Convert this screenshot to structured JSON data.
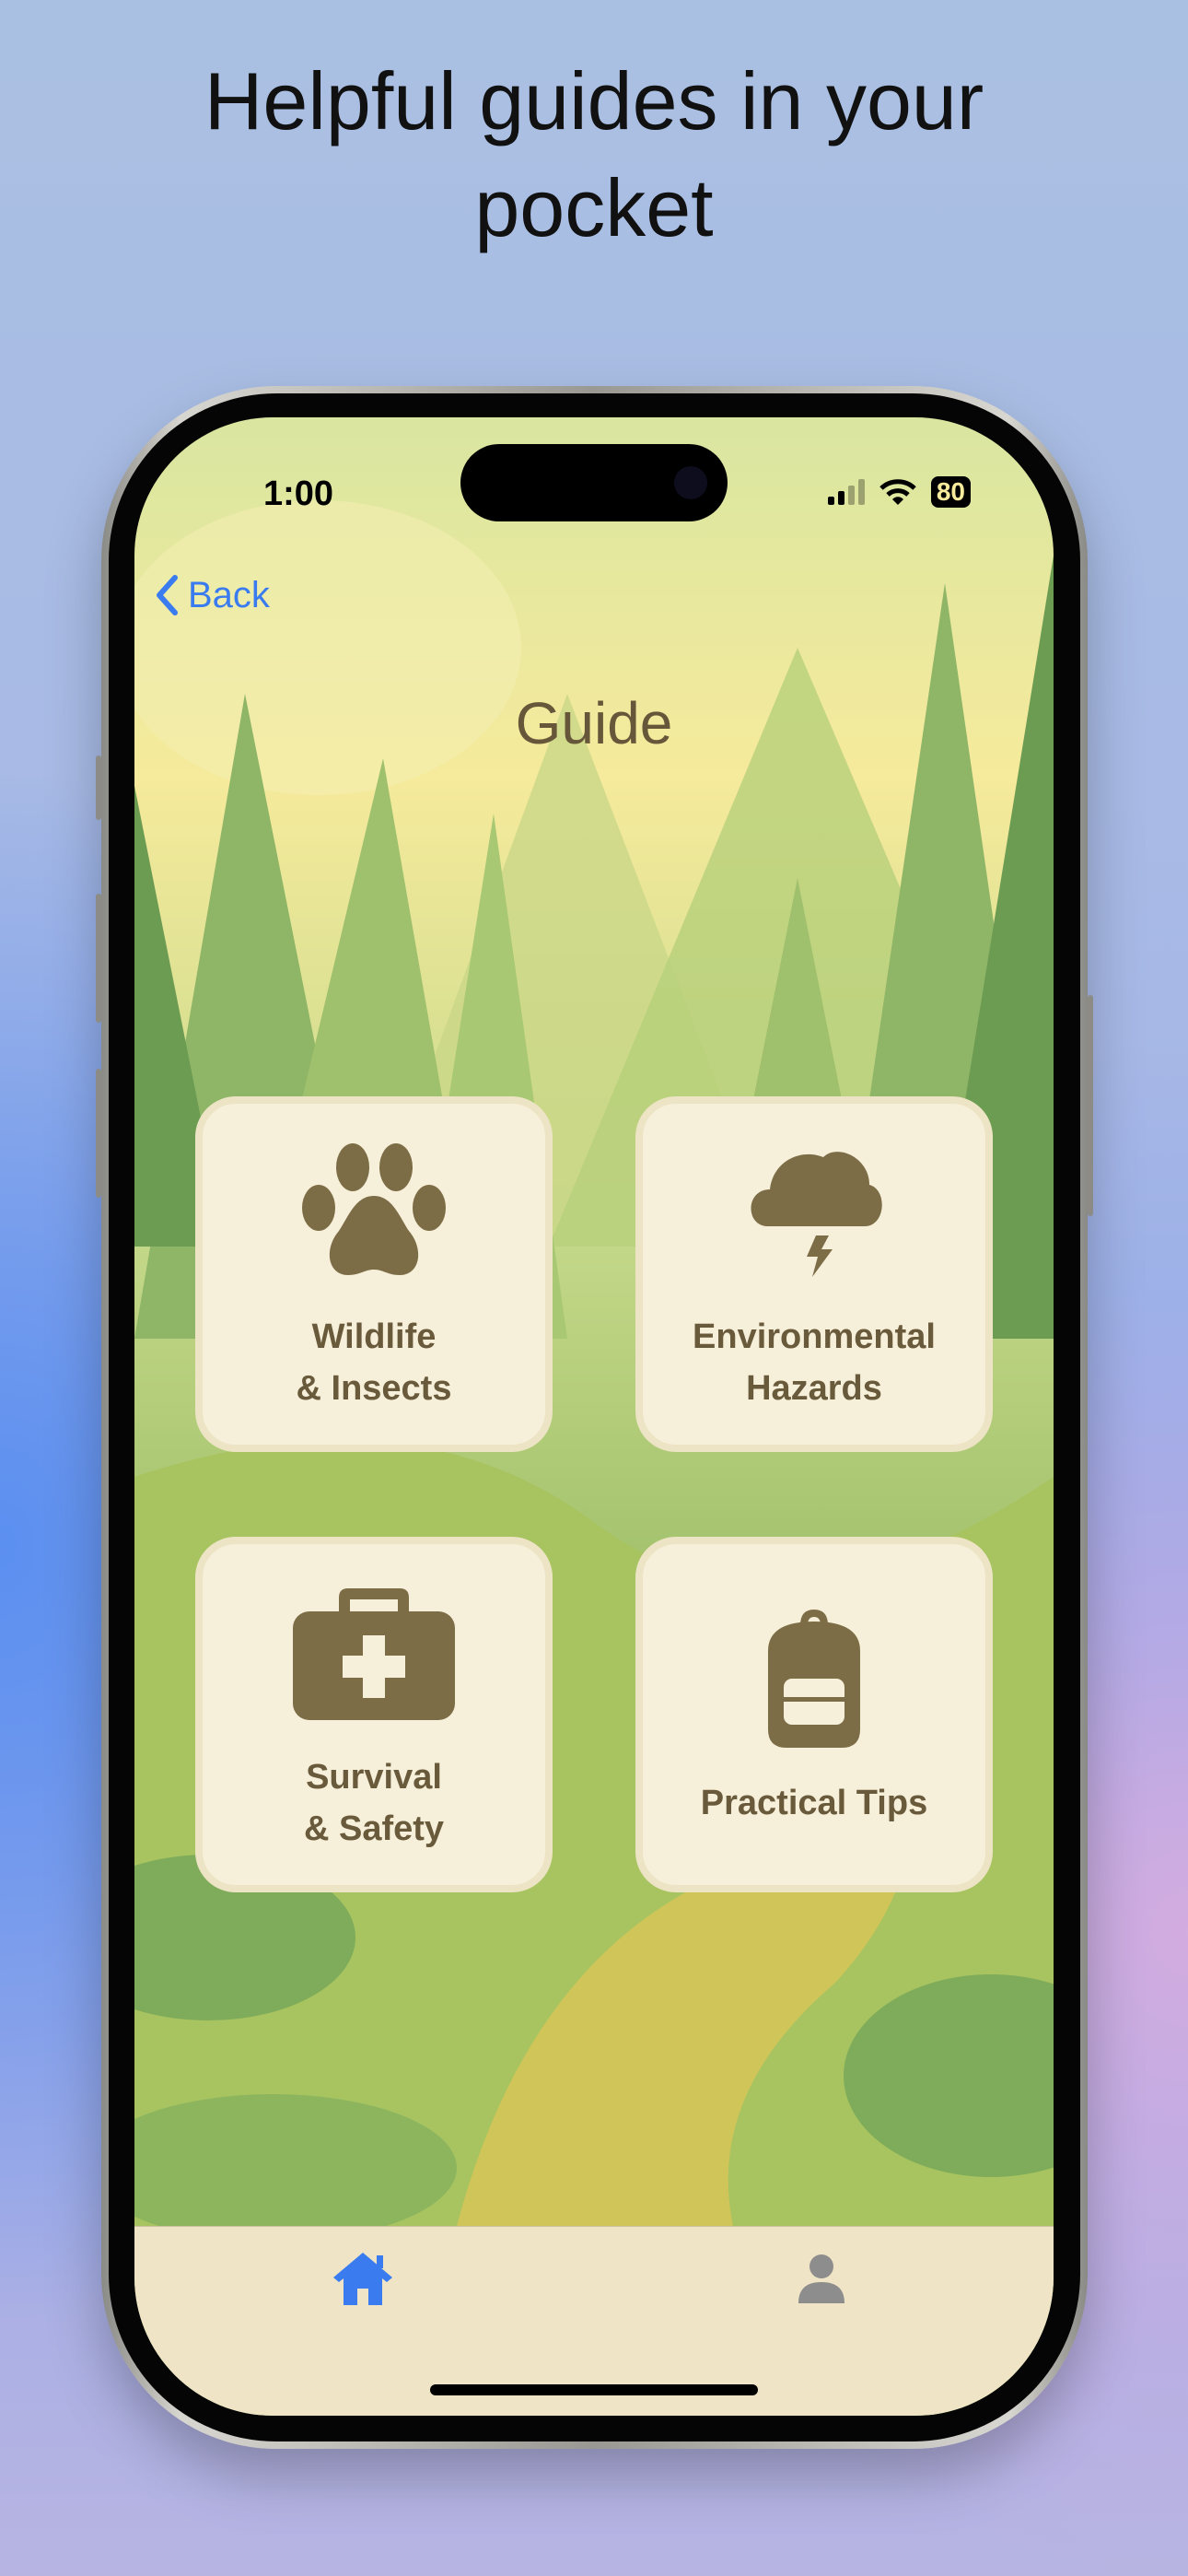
{
  "headline": {
    "line1": "Helpful guides in your",
    "line2": "pocket"
  },
  "status_bar": {
    "time": "1:00",
    "battery": "80"
  },
  "nav": {
    "back_label": "Back",
    "title": "Guide"
  },
  "cards": [
    {
      "label1": "Wildlife",
      "label2": "& Insects",
      "icon": "paw-icon"
    },
    {
      "label1": "Environmental",
      "label2": "Hazards",
      "icon": "storm-cloud-icon"
    },
    {
      "label1": "Survival",
      "label2": "& Safety",
      "icon": "first-aid-kit-icon"
    },
    {
      "label1": "Practical Tips",
      "label2": "",
      "icon": "backpack-icon"
    }
  ],
  "tab_bar": {
    "items": [
      {
        "icon": "home-icon",
        "active": true
      },
      {
        "icon": "person-icon",
        "active": false
      }
    ]
  },
  "colors": {
    "accent": "#3a7cf0",
    "icon_brown": "#7d6d47",
    "card_bg": "#f6efd9"
  }
}
